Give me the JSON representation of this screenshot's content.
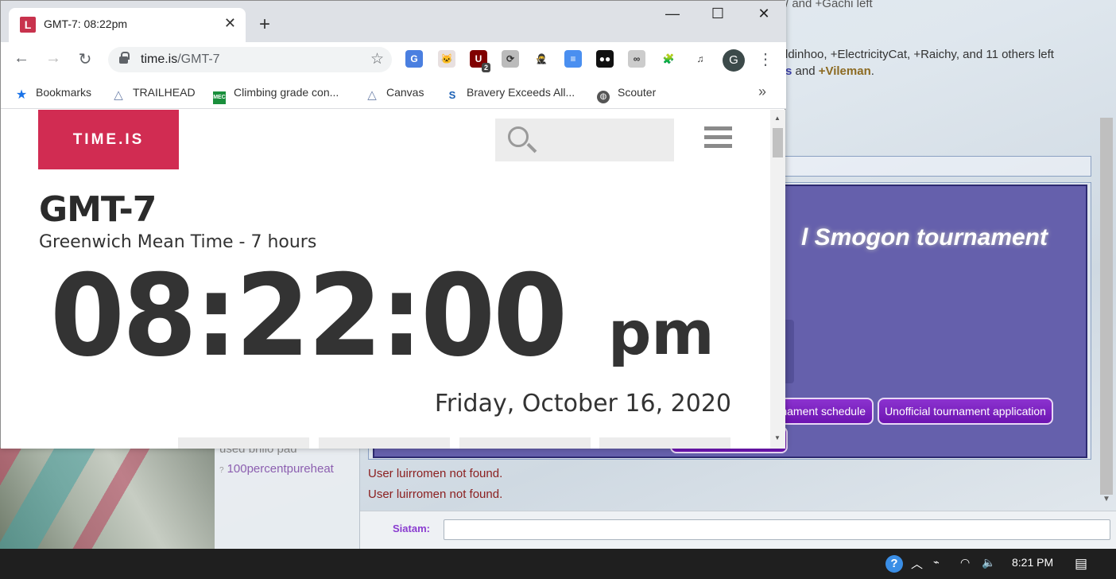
{
  "background_app": {
    "chat_lines": {
      "line1_text": "ldinhoo, +ElectricityCat, +Raichy, and 11 others left",
      "line2_link1": "s",
      "line2_and": " and ",
      "line2_link2": "+Vileman",
      "line2_end": ".",
      "top_fragment": "/ and +Gachi left"
    },
    "tournament_title": "l Smogon tournament",
    "buttons": {
      "schedule": "nament schedule",
      "application": "Unofficial tournament application"
    },
    "errors": [
      "User luirromen not found.",
      "User luirromen not found."
    ],
    "userlist": [
      {
        "name": "used brillo pad",
        "symbol": ""
      },
      {
        "name": "100percentpureheat",
        "symbol": "?"
      }
    ],
    "input_label": "Siatam:"
  },
  "browser": {
    "tab_title": "GMT-7: 08:22pm",
    "tab_favicon": "L",
    "url_host": "time.is",
    "url_path": "/GMT-7",
    "profile_initial": "G",
    "extensions": [
      {
        "name": "google-translate-icon",
        "color": "#4a7fe0",
        "glyph": "G"
      },
      {
        "name": "cat-extension-icon",
        "color": "#e8e0e0",
        "glyph": "🐱"
      },
      {
        "name": "ublock-icon",
        "color": "#800000",
        "glyph": "U",
        "badge": "2"
      },
      {
        "name": "sync-icon",
        "color": "#bbbbbb",
        "glyph": "⟳"
      },
      {
        "name": "incognito-icon",
        "color": "#ffffff",
        "glyph": "🥷"
      },
      {
        "name": "docs-icon",
        "color": "#4a8ff0",
        "glyph": "≡"
      },
      {
        "name": "tampermonkey-icon",
        "color": "#111111",
        "glyph": "●●"
      },
      {
        "name": "infinity-icon",
        "color": "#cccccc",
        "glyph": "∞"
      },
      {
        "name": "puzzle-extensions-icon",
        "color": "#ffffff",
        "glyph": "🧩"
      },
      {
        "name": "media-queue-icon",
        "color": "#ffffff",
        "glyph": "♫"
      }
    ],
    "bookmarks": [
      {
        "label": "Bookmarks",
        "icon": "star-icon"
      },
      {
        "label": "TRAILHEAD",
        "icon": "trailhead-icon"
      },
      {
        "label": "Climbing grade con...",
        "icon": "mec-icon"
      },
      {
        "label": "Canvas",
        "icon": "canvas-icon"
      },
      {
        "label": "Bravery Exceeds All...",
        "icon": "bravery-icon"
      },
      {
        "label": "Scouter",
        "icon": "globe-icon"
      }
    ],
    "bookmarks_more": "»"
  },
  "page": {
    "logo": "TIME.IS",
    "timezone": "GMT-7",
    "timezone_desc": "Greenwich Mean Time - 7 hours",
    "time": "08:22:00",
    "ampm": "pm",
    "date": "Friday, October 16, 2020"
  },
  "taskbar": {
    "clock": "8:21 PM"
  }
}
